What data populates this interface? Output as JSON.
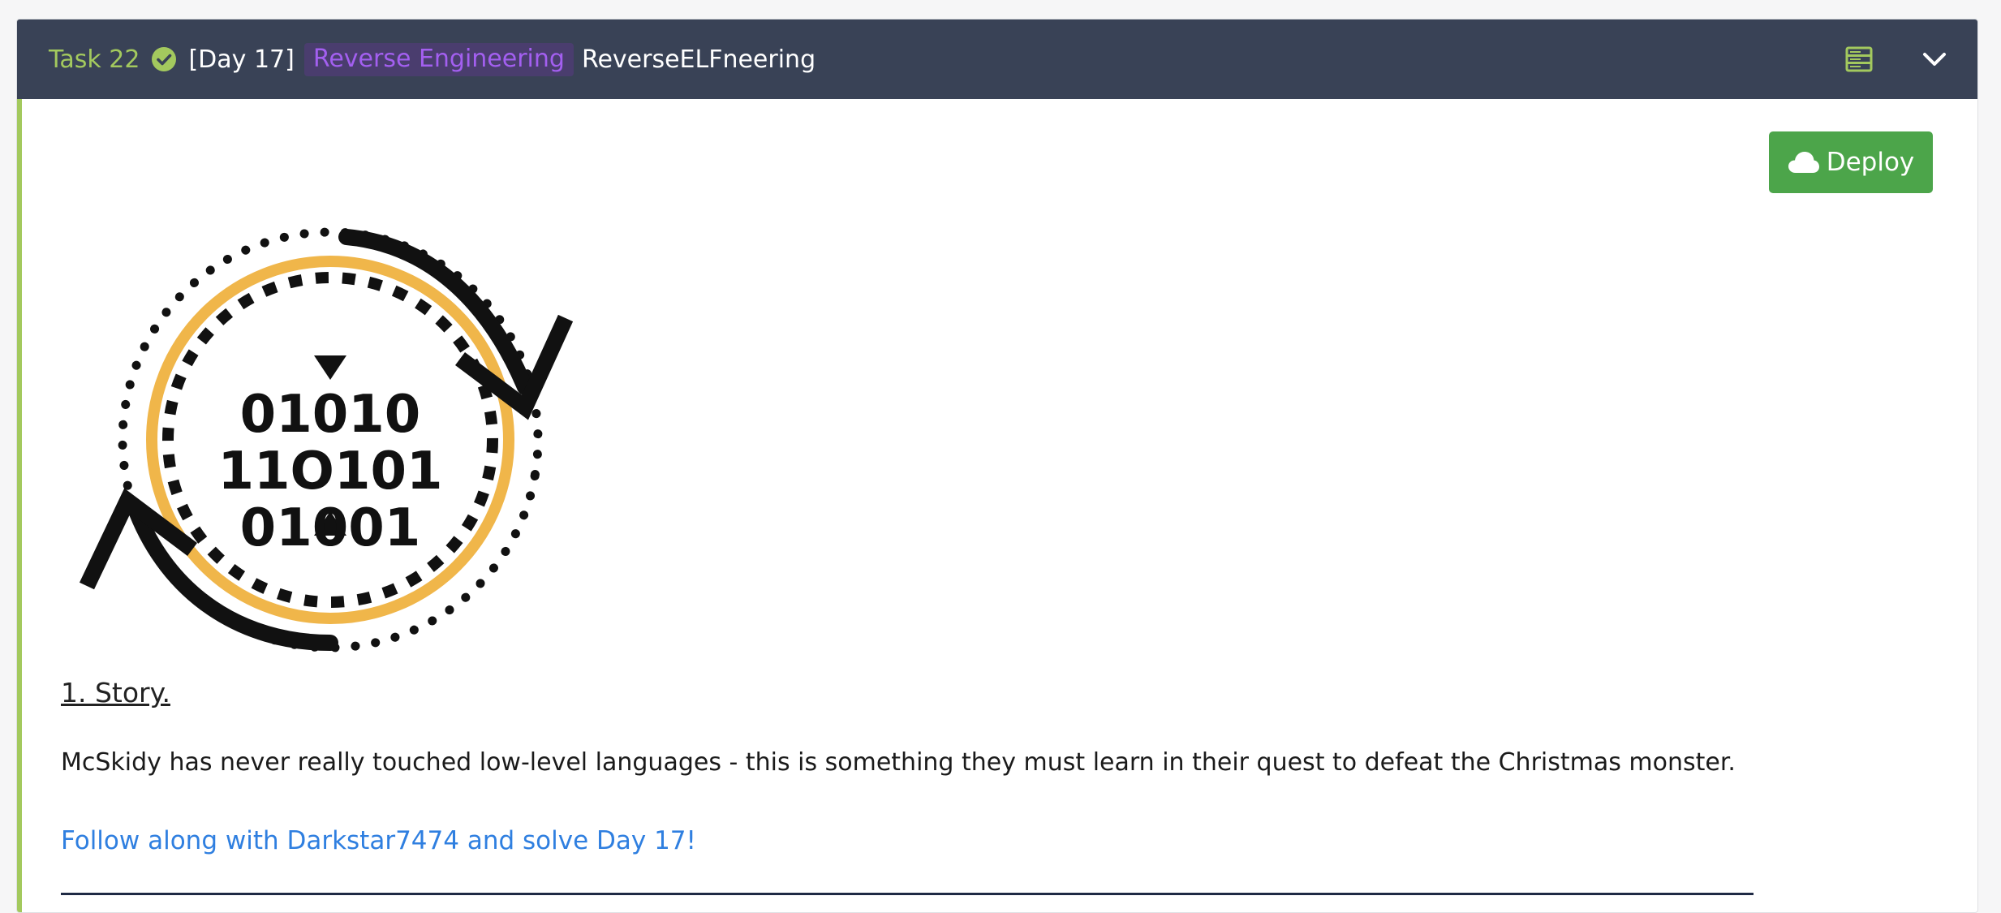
{
  "header": {
    "task_number": "Task 22",
    "day": "[Day 17]",
    "tag": "Reverse Engineering",
    "title": "ReverseELFneering"
  },
  "deploy": {
    "label": "Deploy"
  },
  "logo": {
    "binary_rows": [
      "01010",
      "11O101",
      "01001"
    ]
  },
  "content": {
    "heading": "1. Story.",
    "paragraph": "McSkidy has never really touched low-level languages - this is something they must learn in their quest to defeat the Christmas monster.",
    "link": "Follow along with Darkstar7474 and solve Day 17!"
  },
  "colors": {
    "header_bg": "#394256",
    "accent_green": "#a3c95e",
    "tag_purple": "#a35ff0",
    "deploy_green": "#4ca54a",
    "link_blue": "#2f7fe0",
    "logo_orange": "#f0b64a"
  },
  "icons": [
    "check-circle-icon",
    "server-icon",
    "chevron-down-icon",
    "cloud-icon"
  ]
}
